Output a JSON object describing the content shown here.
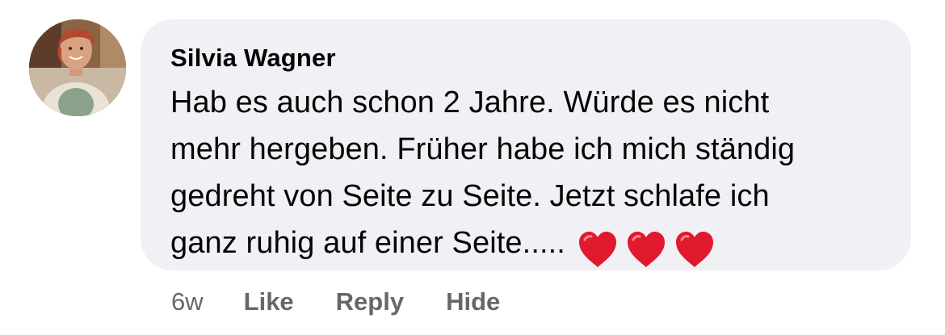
{
  "comment": {
    "author": "Silvia Wagner",
    "lines": [
      "Hab es auch schon 2 Jahre. Würde es nicht",
      "mehr hergeben. Früher habe ich mich ständig",
      "gedreht von Seite zu Seite. Jetzt schlafe ich",
      "ganz ruhig auf einer Seite....."
    ],
    "emoji": [
      "heart-icon",
      "heart-icon",
      "heart-icon"
    ],
    "avatar_icon": "avatar"
  },
  "actions": {
    "time": "6w",
    "like_label": "Like",
    "reply_label": "Reply",
    "hide_label": "Hide"
  },
  "colors": {
    "bubble": "#f0f0f5",
    "text": "#050505",
    "meta": "#65676b",
    "heart": "#e0192e"
  }
}
